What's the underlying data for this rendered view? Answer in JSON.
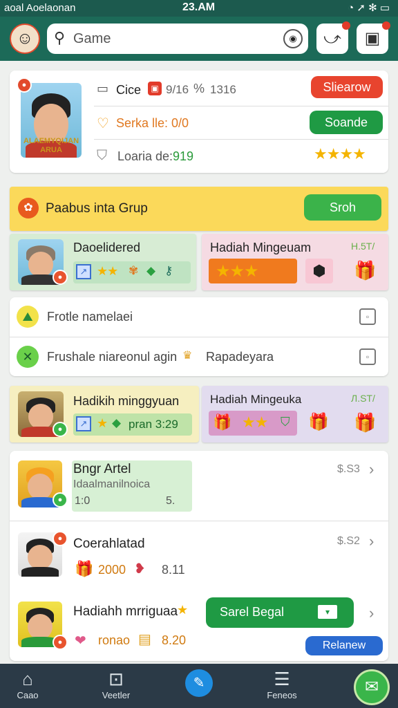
{
  "status_bar": {
    "left": "aoal Aoelaonan",
    "time": "23.AM",
    "right": "◔ ➚ ✻ ▭"
  },
  "header": {
    "search_placeholder": "Game"
  },
  "profile": {
    "avatar_caption": "ALAEMYQIJAN ARUA",
    "row1_label": "Cice",
    "row1_value": "9/16",
    "row1_value2": "1316",
    "row1_button": "Sliearow",
    "row2_label": "Serka lle: 0/0",
    "row2_button": "Soande",
    "row3_label": "Loaria de:",
    "row3_value": "919",
    "row3_stars": "★★★★"
  },
  "group_banner": {
    "label": "Paabus inta Grup",
    "button": "Sroh"
  },
  "reward_row1": {
    "left_title": "Daoelidered",
    "right_title": "Hadiah Mingeuam",
    "right_value": "H.5T/"
  },
  "list_rows": [
    {
      "label": "Frotle namelaei"
    },
    {
      "label": "Frushale niareonul agin",
      "extra": "Rapadeyara"
    }
  ],
  "reward_row2": {
    "left_title": "Hadikih minggyuan",
    "left_value": "pran 3:29",
    "right_title": "Hadiah Mingeuka",
    "right_value": "Л.ST/"
  },
  "players": [
    {
      "name": "Bngr Artel",
      "sub": "Idaalmanilnoica",
      "v1": "1:0",
      "v2": "5.",
      "price": "$.S3"
    },
    {
      "name": "Coerahlatad",
      "v1": "2000",
      "v2": "8.11",
      "price": "$.S2"
    },
    {
      "name": "Hadiahh mrriguaa",
      "v1": "ronao",
      "v2": "8.20",
      "button": "Sarel Begal",
      "button2": "Relanew"
    }
  ],
  "bottom_nav": [
    {
      "label": "Caao"
    },
    {
      "label": "Veetler"
    },
    {
      "label": "Feneos"
    }
  ]
}
